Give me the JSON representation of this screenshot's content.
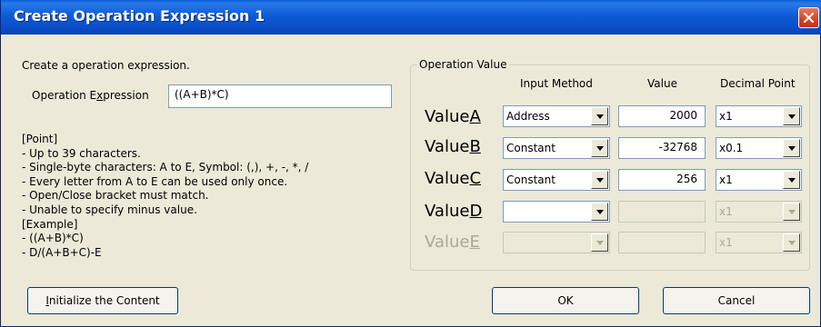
{
  "window": {
    "title": "Create Operation Expression 1"
  },
  "intro": "Create a operation expression.",
  "expression": {
    "label_pre": "Operation E",
    "label_acc": "x",
    "label_post": "pression",
    "value": "((A+B)*C)"
  },
  "point_lines": [
    "[Point]",
    "- Up to 39 characters.",
    "- Single-byte characters: A to E, Symbol: (,), +, -, *, /",
    "- Every letter from A to E can be used only once.",
    "- Open/Close bracket must match.",
    "- Unable to specify minus value.",
    "[Example]",
    "- ((A+B)*C)",
    "- D/(A+B+C)-E"
  ],
  "group": {
    "label": "Operation Value",
    "col_input_method": "Input Method",
    "col_value": "Value",
    "col_decimal": "Decimal Point"
  },
  "rows": [
    {
      "label_pre": "Value",
      "label_acc": "A",
      "method": "Address",
      "value": "2000",
      "decimal": "x1",
      "enabled": true
    },
    {
      "label_pre": "Value",
      "label_acc": "B",
      "method": "Constant",
      "value": "-32768",
      "decimal": "x0.1",
      "enabled": true
    },
    {
      "label_pre": "Value",
      "label_acc": "C",
      "method": "Constant",
      "value": "256",
      "decimal": "x1",
      "enabled": true
    },
    {
      "label_pre": "Value",
      "label_acc": "D",
      "method": "",
      "value": "",
      "decimal": "x1",
      "enabled": false
    },
    {
      "label_pre": "Value",
      "label_acc": "E",
      "method": "",
      "value": "",
      "decimal": "x1",
      "enabled": false
    }
  ],
  "buttons": {
    "init_acc": "I",
    "init_rest": "nitialize the Content",
    "ok": "OK",
    "cancel": "Cancel"
  },
  "icons": {
    "close": "close-icon",
    "dropdown": "chevron-down-icon"
  }
}
